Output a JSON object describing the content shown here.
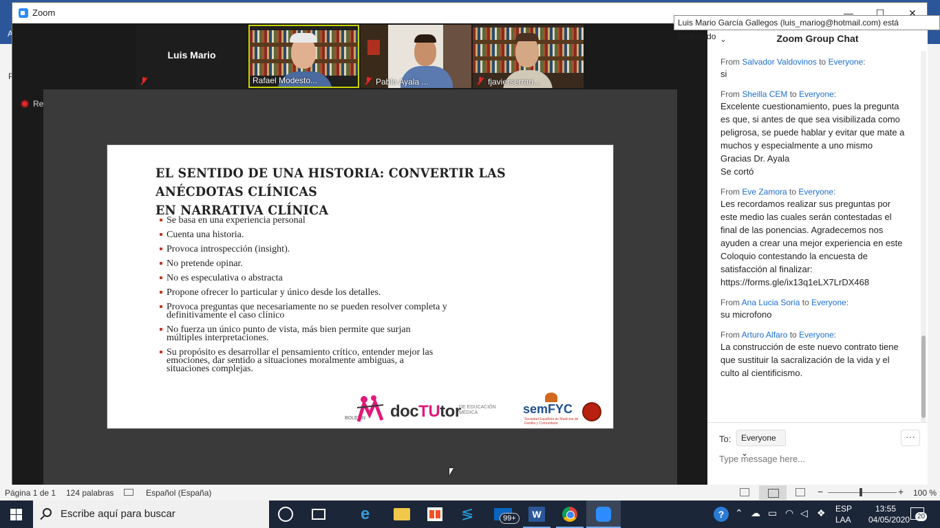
{
  "zoom": {
    "window_title": "Zoom",
    "controls": {
      "minimize": "—",
      "maximize": "☐",
      "close": "✕"
    },
    "participants": [
      {
        "name": "Luis Mario",
        "muted": true,
        "video": false
      },
      {
        "name": "Rafael Modesto...",
        "muted": false,
        "video": true,
        "active_speaker": true
      },
      {
        "name": "Pablo Ayala ...",
        "muted": true,
        "video": true
      },
      {
        "name": "fjavierserran...",
        "muted": true,
        "video": true
      }
    ],
    "recording_label": "Recording",
    "tooltip": "Luis Mario García Gallegos (luis_mariog@hotmail.com) está conectado"
  },
  "slide": {
    "title_line1": "EL SENTIDO DE UNA HISTORIA: CONVERTIR LAS ANÉCDOTAS CLÍNICAS",
    "title_line2": "EN NARRATIVA CLÍNICA",
    "bullets": [
      "Se basa en una experiencia personal",
      "Cuenta una historia.",
      "Provoca introspección (insight).",
      "No pretende opinar.",
      "No es especulativa o abstracta",
      "Propone ofrecer lo particular y único desde los detalles.",
      "Provoca preguntas que necesariamente no se pueden resolver completa y definitivamente el caso clínico",
      "No fuerza un único punto de vista, más bien permite que surjan múltiples interpretaciones.",
      "Su propósito es desarrollar el pensamiento crítico, entender mejor las emociones, dar sentido a situaciones moralmente ambiguas, a situaciones complejas."
    ],
    "logo_boletin": "BOLETÍN",
    "logo_doc": "doc",
    "logo_tu": "TU",
    "logo_tor": "tor",
    "logo_sub": "DE EDUCACIÓN MÉDICA",
    "semfyc_name": "semFYC",
    "semfyc_sub": "Sociedad Española de Medicina de Familia y Comunitaria"
  },
  "chat": {
    "title": "Zoom Group Chat",
    "messages": [
      {
        "from": "Salvador Valdovinos",
        "to": "Everyone",
        "text": "si"
      },
      {
        "from": "Sheilla CEM",
        "to": "Everyone",
        "text": "Excelente cuestionamiento, pues la pregunta es que, si antes de que sea visibilizada como peligrosa, se puede hablar y evitar que mate a muchos y especialmente a uno mismo\nGracias Dr. Ayala\nSe cortó"
      },
      {
        "from": "Eve Zamora",
        "to": "Everyone",
        "text": "Les recordamos realizar sus preguntas por este medio las cuales serán contestadas el final de las ponencias. Agradecemos nos ayuden a crear una mejor experiencia en este Coloquio contestando la encuesta de satisfacción al finalizar:\nhttps://forms.gle/ix13q1eLX7LrDX468"
      },
      {
        "from": "Ana Lucia Soria",
        "to": "Everyone",
        "text": "su microfono"
      },
      {
        "from": "Arturo Alfaro",
        "to": "Everyone",
        "text": "La construcción de este nuevo contrato tiene que sustituir la sacralización de la vida y el culto al cientificismo."
      }
    ],
    "from_word": "From",
    "to_word": "to",
    "to_label": "To:",
    "recipient": "Everyone ⌄",
    "more": "···",
    "input_placeholder": "Type message here..."
  },
  "word_status": {
    "page": "Página 1 de 1",
    "words": "124 palabras",
    "language": "Español (España)",
    "zoom_level": "100 %",
    "zoom_percent": 100
  },
  "taskbar": {
    "search_placeholder": "Escribe aquí para buscar",
    "mail_badge": "99+",
    "word_letter": "W",
    "lang_line1": "ESP",
    "lang_line2": "LAA",
    "time": "13:55",
    "date": "04/05/2020",
    "notifications": "20"
  }
}
